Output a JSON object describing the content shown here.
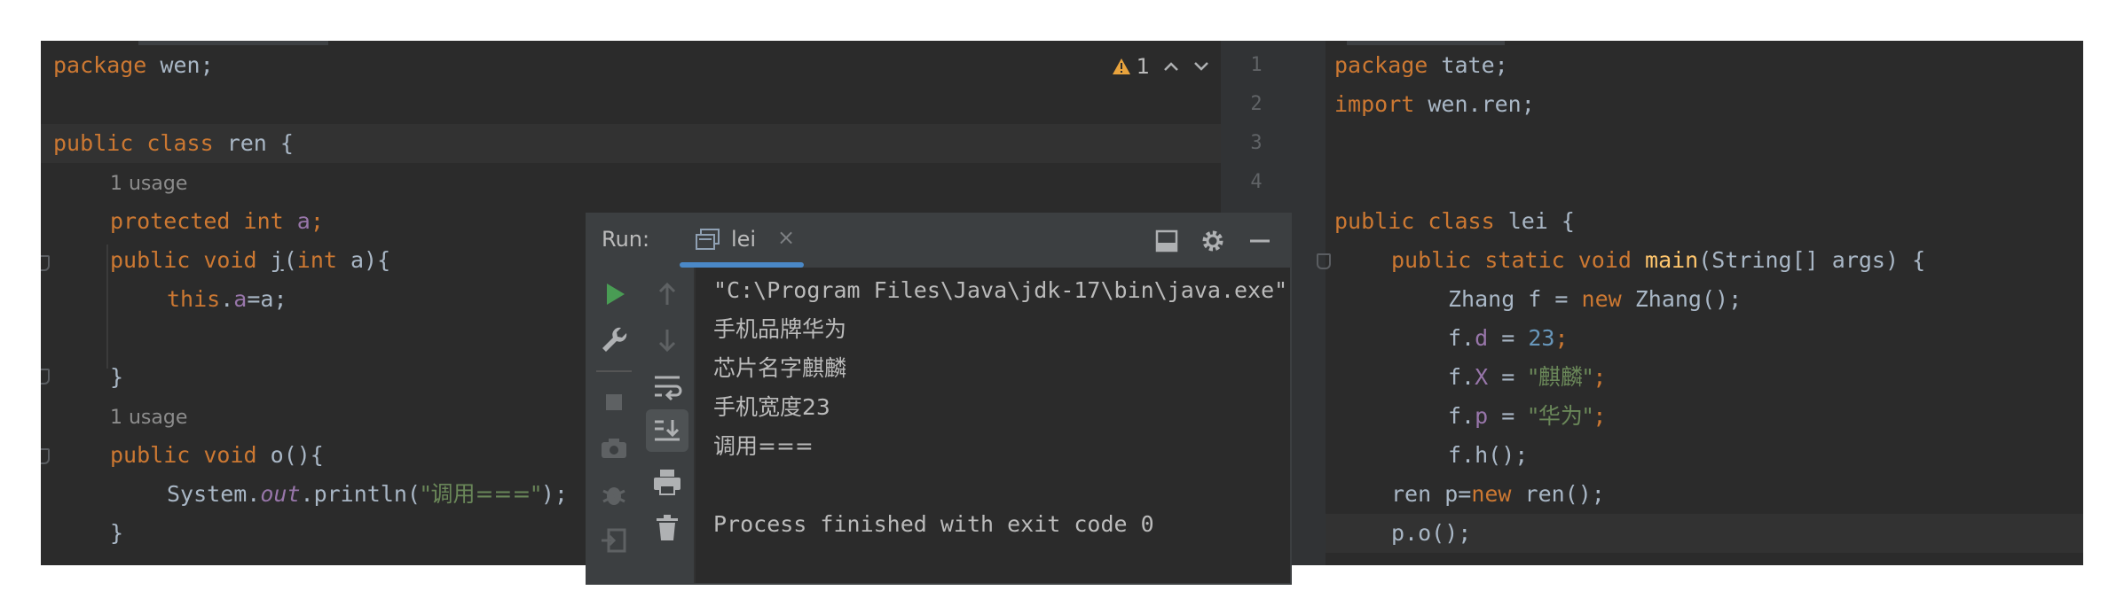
{
  "left_editor": {
    "warning_count": "1",
    "lines": {
      "l1_kw": "package",
      "l1_rest": " wen;",
      "l3_kw1": "public",
      "l3_kw2": "class",
      "l3_rest": " ren {",
      "hint1": "1 usage",
      "l5_kw1": "protected",
      "l5_kw2": "int",
      "l5_fld": "a",
      "l5_end": ";",
      "l6_kw1": "public",
      "l6_kw2": "void",
      "l6_fn": "j",
      "l6_p1": "(",
      "l6_kw3": "int",
      "l6_p2": " a){",
      "l7_kw": "this",
      "l7_dot": ".",
      "l7_fld": "a",
      "l7_rest": "=a;",
      "l9": "}",
      "hint2": "1 usage",
      "l11_kw1": "public",
      "l11_kw2": "void",
      "l11_rest": " o(){",
      "l12_a": "System.",
      "l12_out": "out",
      "l12_b": ".println(",
      "l12_str": "\"调用===\"",
      "l12_c": ");",
      "l13": "}"
    }
  },
  "right_editor": {
    "line_numbers": [
      "1",
      "2",
      "3",
      "4"
    ],
    "lines": {
      "r1_kw": "package",
      "r1_rest": " tate;",
      "r2_kw": "import",
      "r2_rest": " wen.ren;",
      "r5_kw1": "public",
      "r5_kw2": "class",
      "r5_rest": " lei {",
      "r6_kw1": "public",
      "r6_kw2": "static",
      "r6_kw3": "void",
      "r6_fn": "main",
      "r6_rest": "(String[] args) {",
      "r7_a": "Zhang f = ",
      "r7_kw": "new",
      "r7_b": " Zhang();",
      "r8_a": "f.",
      "r8_fld": "d",
      "r8_b": " = ",
      "r8_num": "23",
      "r8_c": ";",
      "r9_a": "f.",
      "r9_fld": "X",
      "r9_b": " = ",
      "r9_str": "\"麒麟\"",
      "r9_c": ";",
      "r10_a": "f.",
      "r10_fld": "p",
      "r10_b": " = ",
      "r10_str": "\"华为\"",
      "r10_c": ";",
      "r11": "f.h();",
      "r12_a": "ren p=",
      "r12_kw": "new",
      "r12_b": " ren();",
      "r13": "p.o();"
    }
  },
  "run_window": {
    "title": "Run:",
    "tab_label": "lei",
    "console": [
      "\"C:\\Program Files\\Java\\jdk-17\\bin\\java.exe\"",
      "手机品牌华为",
      "芯片名字麒麟",
      "手机宽度23",
      "调用===",
      "",
      "Process finished with exit code 0"
    ]
  },
  "colors": {
    "editor_bg": "#2b2b2b",
    "keyword": "#cc7832",
    "field": "#9876aa",
    "string": "#6a8759",
    "number": "#6897bb",
    "function": "#ffc66d",
    "run_green": "#499c54",
    "tab_underline": "#4a88c7"
  }
}
